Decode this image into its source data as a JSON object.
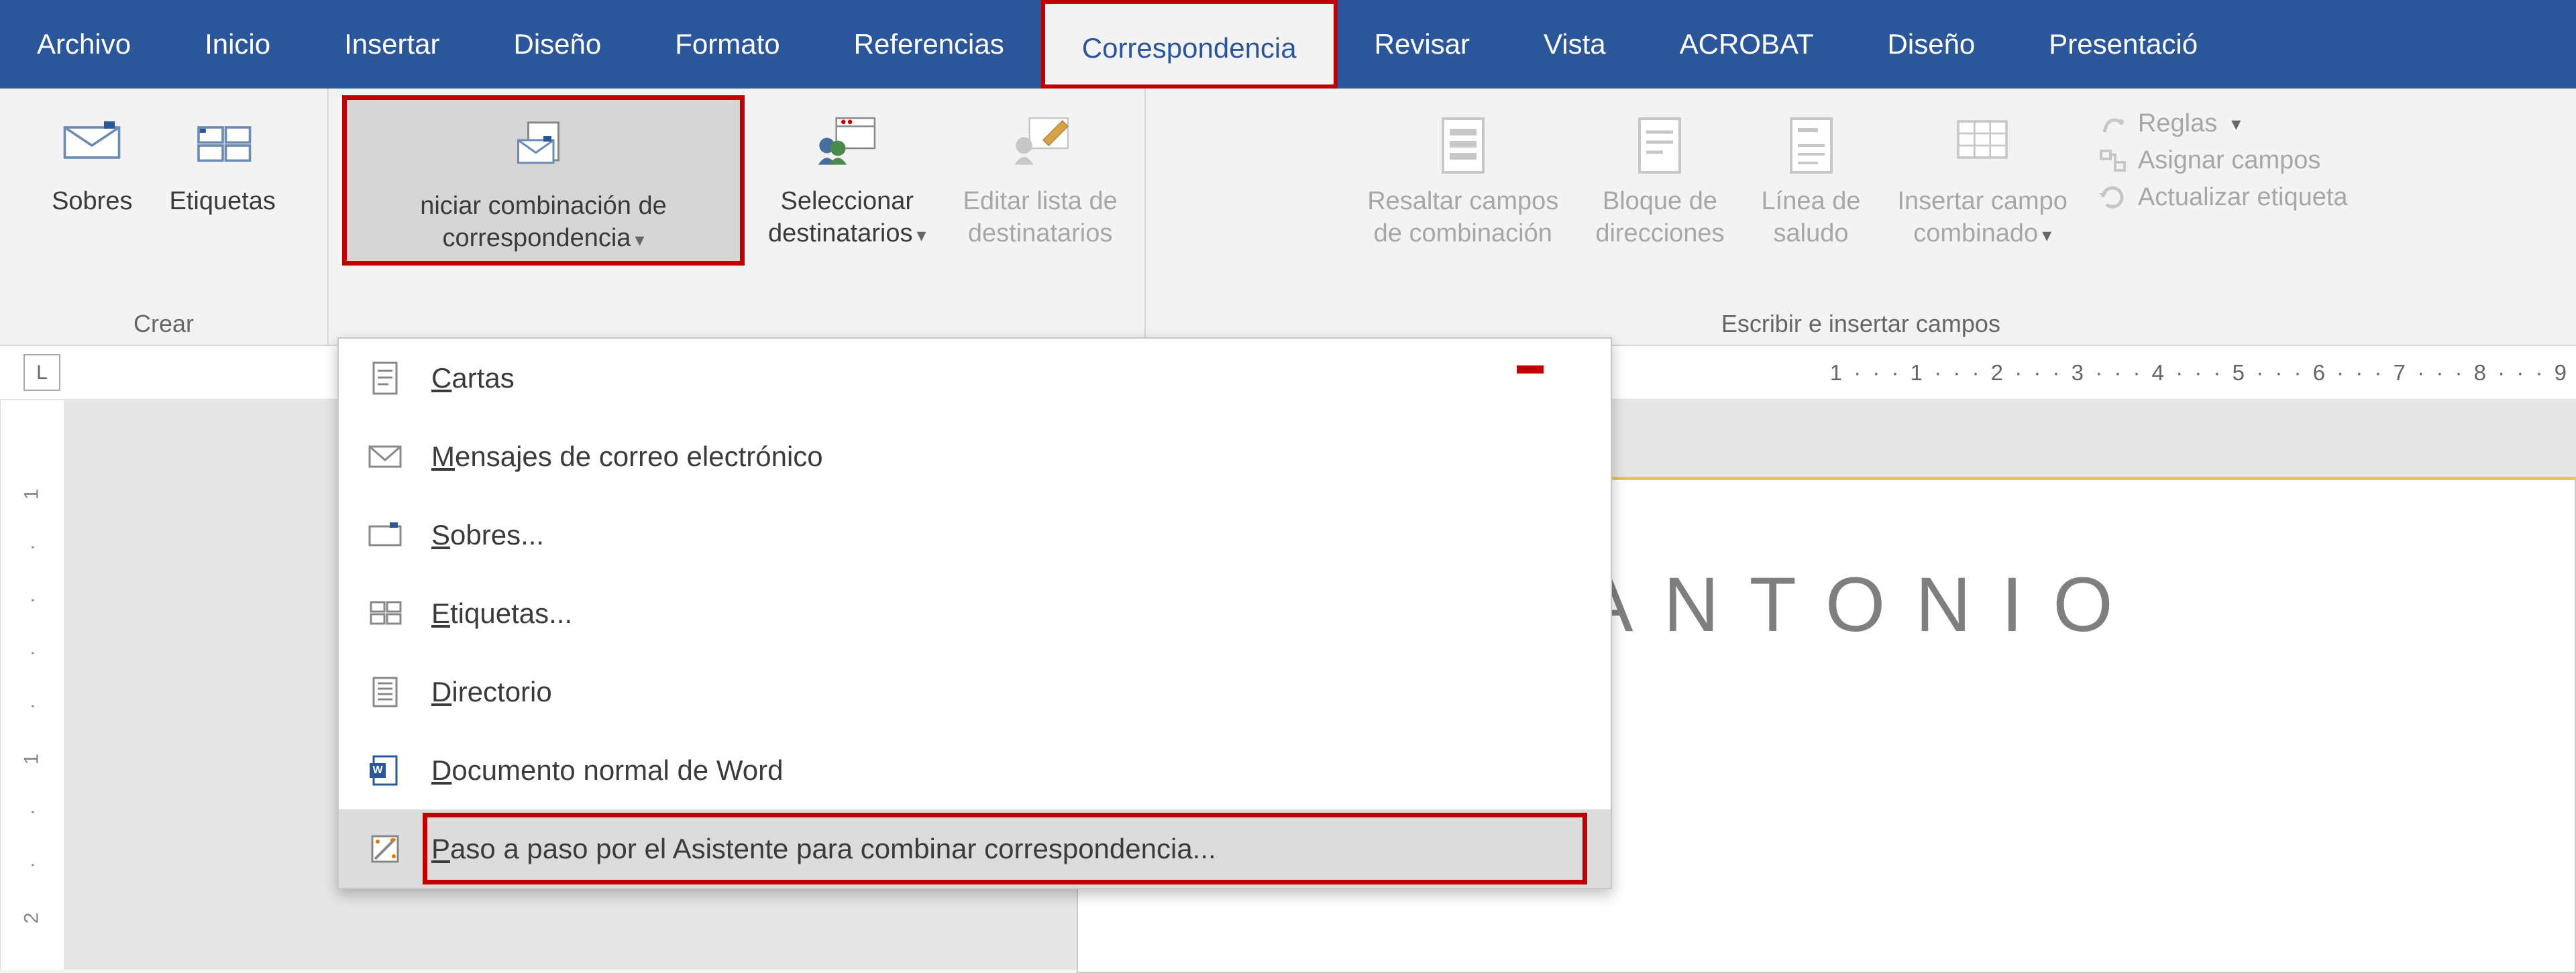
{
  "tabs": {
    "archivo": "Archivo",
    "inicio": "Inicio",
    "insertar": "Insertar",
    "diseno": "Diseño",
    "formato": "Formato",
    "referencias": "Referencias",
    "correspondencia": "Correspondencia",
    "revisar": "Revisar",
    "vista": "Vista",
    "acrobat": "ACROBAT",
    "diseno2": "Diseño",
    "presentacion": "Presentació"
  },
  "ribbon": {
    "group_crear": "Crear",
    "sobres": "Sobres",
    "etiquetas": "Etiquetas",
    "iniciar_combinacion": "niciar combinación de\ncorrespondencia",
    "seleccionar_dest": "Seleccionar\ndestinatarios",
    "editar_lista": "Editar lista de\ndestinatarios",
    "resaltar": "Resaltar campos\nde combinación",
    "bloque": "Bloque de\ndirecciones",
    "linea_saludo": "Línea de\nsaludo",
    "insertar_campo": "Insertar campo\ncombinado",
    "group_escribir": "Escribir e insertar campos",
    "reglas": "Reglas",
    "asignar": "Asignar campos",
    "actualizar": "Actualizar etiqueta"
  },
  "menu": {
    "cartas": "Cartas",
    "mensajes": "Mensajes de correo electrónico",
    "sobres": "Sobres...",
    "etiquetas": "Etiquetas...",
    "directorio": "Directorio",
    "documento_normal": "Documento normal de Word",
    "asistente": "Paso a paso por el Asistente para combinar correspondencia..."
  },
  "ruler": {
    "corner": "L",
    "numbers_right": "1 · · · 1 · · · 2 · · · 3 · · · 4 · · · 5 · · · 6 · · · 7 · · · 8 · · · 9"
  },
  "document": {
    "title": "JUAN  ANTONIO"
  }
}
